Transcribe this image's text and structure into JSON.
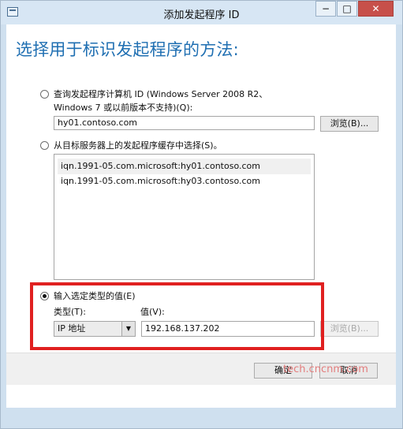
{
  "window": {
    "title": "添加发起程序 ID",
    "minimize": "−",
    "maximize": "□",
    "close": "✕"
  },
  "page": {
    "heading": "选择用于标识发起程序的方法:"
  },
  "option_query": {
    "label_line1": "查询发起程序计算机 ID (Windows Server 2008 R2、",
    "label_line2": "Windows 7 或以前版本不支持)(Q):",
    "value": "hy01.contoso.com",
    "browse_label": "浏览(B)..."
  },
  "option_cache": {
    "label": "从目标服务器上的发起程序缓存中选择(S)。",
    "items": [
      "iqn.1991-05.com.microsoft:hy01.contoso.com",
      "iqn.1991-05.com.microsoft:hy03.contoso.com"
    ]
  },
  "option_manual": {
    "label": "输入选定类型的值(E)",
    "type_label": "类型(T):",
    "type_value": "IP 地址",
    "value_label": "值(V):",
    "value": "192.168.137.202",
    "browse_label": "浏览(B)..."
  },
  "footer": {
    "ok_label": "确定",
    "cancel_label": "取消"
  },
  "watermark": "tech.cncnm.com",
  "colors": {
    "heading": "#1f6fb2",
    "highlight": "#e02020",
    "close_button": "#c7504a"
  }
}
